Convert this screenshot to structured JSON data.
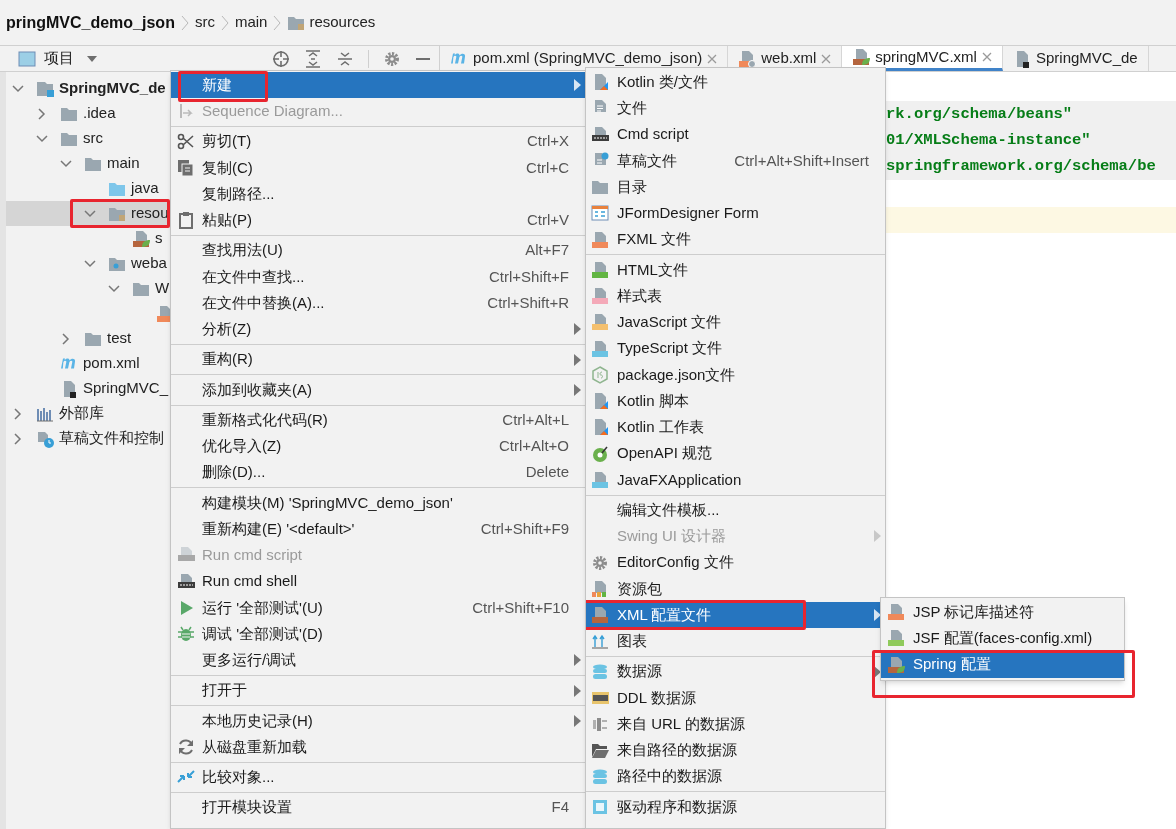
{
  "breadcrumb": [
    {
      "label": "pringMVC_demo_json",
      "kind": "project"
    },
    {
      "label": "src",
      "kind": "plain"
    },
    {
      "label": "main",
      "kind": "plain"
    },
    {
      "label": "resources",
      "kind": "resources"
    }
  ],
  "project_panel": {
    "title": "项目",
    "tree": [
      {
        "label": "SpringMVC_de",
        "kind": "module",
        "expanded": true,
        "selected": false,
        "children": [
          {
            "label": ".idea",
            "kind": "folder",
            "expanded": false,
            "selected": false
          },
          {
            "label": "src",
            "kind": "folder",
            "expanded": true,
            "selected": false,
            "children": [
              {
                "label": "main",
                "kind": "folder",
                "expanded": true,
                "selected": false,
                "children": [
                  {
                    "label": "java",
                    "kind": "source",
                    "selected": false
                  },
                  {
                    "label": "resou",
                    "kind": "resources",
                    "expanded": true,
                    "selected": true,
                    "annotated": true,
                    "children": [
                      {
                        "label": "s",
                        "kind": "spring-xml",
                        "selected": false
                      }
                    ]
                  },
                  {
                    "label": "weba",
                    "kind": "web",
                    "expanded": true,
                    "selected": false,
                    "children": [
                      {
                        "label": "W",
                        "kind": "folder",
                        "expanded": true,
                        "selected": false,
                        "children": [
                          {
                            "kind": "xml",
                            "selected": false
                          }
                        ]
                      }
                    ]
                  }
                ]
              },
              {
                "label": "test",
                "kind": "folder",
                "expanded": false,
                "selected": false
              }
            ]
          },
          {
            "label": "pom.xml",
            "kind": "maven",
            "selected": false
          },
          {
            "label": "SpringMVC_",
            "kind": "iml",
            "selected": false
          }
        ]
      },
      {
        "label": "外部库",
        "kind": "libraries",
        "expanded": false,
        "selected": false
      },
      {
        "label": "草稿文件和控制",
        "kind": "scratches",
        "expanded": false,
        "selected": false
      }
    ]
  },
  "tabs": [
    {
      "label": "pom.xml (SpringMVC_demo_json)",
      "kind": "maven",
      "selected": false,
      "closable": true
    },
    {
      "label": "web.xml",
      "kind": "web-xml",
      "selected": false,
      "closable": true
    },
    {
      "label": "springMVC.xml",
      "kind": "spring-xml",
      "selected": true,
      "closable": true
    },
    {
      "label": "SpringMVC_de",
      "kind": "iml",
      "selected": false,
      "closable": false
    }
  ],
  "editor": {
    "lines": [
      {
        "kind": "attribute",
        "text": "rk.org/schema/beans\""
      },
      {
        "kind": "attribute",
        "text": "01/XMLSchema-instance\""
      },
      {
        "kind": "attribute",
        "text": "springframework.org/schema/be"
      },
      {
        "kind": "blank"
      },
      {
        "kind": "current"
      }
    ]
  },
  "context_menu": {
    "groups": [
      [
        {
          "label": "新建",
          "selected": true,
          "disabled": false,
          "submenu": true,
          "annotated": true
        },
        {
          "label": "Sequence Diagram...",
          "selected": false,
          "disabled": true,
          "submenu": false
        }
      ],
      [
        {
          "label": "剪切(T)",
          "shortcut": "Ctrl+X",
          "selected": false,
          "disabled": false,
          "submenu": false
        },
        {
          "label": "复制(C)",
          "shortcut": "Ctrl+C",
          "selected": false,
          "disabled": false,
          "submenu": false
        },
        {
          "label": "复制路径...",
          "selected": false,
          "disabled": false,
          "submenu": false
        },
        {
          "label": "粘贴(P)",
          "shortcut": "Ctrl+V",
          "selected": false,
          "disabled": false,
          "submenu": false
        }
      ],
      [
        {
          "label": "查找用法(U)",
          "shortcut": "Alt+F7",
          "selected": false,
          "disabled": false,
          "submenu": false
        },
        {
          "label": "在文件中查找...",
          "shortcut": "Ctrl+Shift+F",
          "selected": false,
          "disabled": false,
          "submenu": false
        },
        {
          "label": "在文件中替换(A)...",
          "shortcut": "Ctrl+Shift+R",
          "selected": false,
          "disabled": false,
          "submenu": false
        },
        {
          "label": "分析(Z)",
          "selected": false,
          "disabled": false,
          "submenu": true
        }
      ],
      [
        {
          "label": "重构(R)",
          "selected": false,
          "disabled": false,
          "submenu": true
        }
      ],
      [
        {
          "label": "添加到收藏夹(A)",
          "selected": false,
          "disabled": false,
          "submenu": true
        }
      ],
      [
        {
          "label": "重新格式化代码(R)",
          "shortcut": "Ctrl+Alt+L",
          "selected": false,
          "disabled": false,
          "submenu": false
        },
        {
          "label": "优化导入(Z)",
          "shortcut": "Ctrl+Alt+O",
          "selected": false,
          "disabled": false,
          "submenu": false
        },
        {
          "label": "删除(D)...",
          "shortcut": "Delete",
          "selected": false,
          "disabled": false,
          "submenu": false
        }
      ],
      [
        {
          "label": "构建模块(M) 'SpringMVC_demo_json'",
          "selected": false,
          "disabled": false,
          "submenu": false
        },
        {
          "label": "重新构建(E) '<default>'",
          "shortcut": "Ctrl+Shift+F9",
          "selected": false,
          "disabled": false,
          "submenu": false
        },
        {
          "label": "Run cmd script",
          "selected": false,
          "disabled": true,
          "submenu": false
        },
        {
          "label": "Run cmd shell",
          "selected": false,
          "disabled": false,
          "submenu": false
        },
        {
          "label": "运行 '全部测试'(U)",
          "shortcut": "Ctrl+Shift+F10",
          "selected": false,
          "disabled": false,
          "submenu": false
        },
        {
          "label": "调试 '全部测试'(D)",
          "selected": false,
          "disabled": false,
          "submenu": false
        },
        {
          "label": "更多运行/调试",
          "selected": false,
          "disabled": false,
          "submenu": true
        }
      ],
      [
        {
          "label": "打开于",
          "selected": false,
          "disabled": false,
          "submenu": true
        }
      ],
      [
        {
          "label": "本地历史记录(H)",
          "selected": false,
          "disabled": false,
          "submenu": true
        },
        {
          "label": "从磁盘重新加载",
          "selected": false,
          "disabled": false,
          "submenu": false
        }
      ],
      [
        {
          "label": "比较对象...",
          "selected": false,
          "disabled": false,
          "submenu": false
        }
      ],
      [
        {
          "label": "打开模块设置",
          "shortcut": "F4",
          "selected": false,
          "disabled": false,
          "submenu": false
        }
      ]
    ]
  },
  "new_submenu": {
    "groups": [
      [
        {
          "label": "Kotlin 类/文件",
          "selected": false,
          "disabled": false,
          "submenu": false
        },
        {
          "label": "文件",
          "selected": false,
          "disabled": false,
          "submenu": false
        },
        {
          "label": "Cmd script",
          "selected": false,
          "disabled": false,
          "submenu": false
        },
        {
          "label": "草稿文件",
          "shortcut": "Ctrl+Alt+Shift+Insert",
          "selected": false,
          "disabled": false,
          "submenu": false
        },
        {
          "label": "目录",
          "selected": false,
          "disabled": false,
          "submenu": false
        },
        {
          "label": "JFormDesigner Form",
          "selected": false,
          "disabled": false,
          "submenu": false
        },
        {
          "label": "FXML 文件",
          "selected": false,
          "disabled": false,
          "submenu": false
        }
      ],
      [
        {
          "label": "HTML文件",
          "selected": false,
          "disabled": false,
          "submenu": false
        },
        {
          "label": "样式表",
          "selected": false,
          "disabled": false,
          "submenu": false
        },
        {
          "label": "JavaScript 文件",
          "selected": false,
          "disabled": false,
          "submenu": false
        },
        {
          "label": "TypeScript 文件",
          "selected": false,
          "disabled": false,
          "submenu": false
        },
        {
          "label": "package.json文件",
          "selected": false,
          "disabled": false,
          "submenu": false
        },
        {
          "label": "Kotlin 脚本",
          "selected": false,
          "disabled": false,
          "submenu": false
        },
        {
          "label": "Kotlin 工作表",
          "selected": false,
          "disabled": false,
          "submenu": false
        },
        {
          "label": "OpenAPI 规范",
          "selected": false,
          "disabled": false,
          "submenu": false
        },
        {
          "label": "JavaFXApplication",
          "selected": false,
          "disabled": false,
          "submenu": false
        }
      ],
      [
        {
          "label": "编辑文件模板...",
          "selected": false,
          "disabled": false,
          "submenu": false
        },
        {
          "label": "Swing UI 设计器",
          "selected": false,
          "disabled": true,
          "submenu": true
        },
        {
          "label": "EditorConfig 文件",
          "selected": false,
          "disabled": false,
          "submenu": false
        },
        {
          "label": "资源包",
          "selected": false,
          "disabled": false,
          "submenu": false
        },
        {
          "label": "XML 配置文件",
          "selected": true,
          "disabled": false,
          "submenu": true,
          "annotated": true
        },
        {
          "label": "图表",
          "selected": false,
          "disabled": false,
          "submenu": false
        }
      ],
      [
        {
          "label": "数据源",
          "selected": false,
          "disabled": false,
          "submenu": true
        },
        {
          "label": "DDL 数据源",
          "selected": false,
          "disabled": false,
          "submenu": false
        },
        {
          "label": "来自 URL 的数据源",
          "selected": false,
          "disabled": false,
          "submenu": false
        },
        {
          "label": "来自路径的数据源",
          "selected": false,
          "disabled": false,
          "submenu": false
        },
        {
          "label": "路径中的数据源",
          "selected": false,
          "disabled": false,
          "submenu": false
        }
      ],
      [
        {
          "label": "驱动程序和数据源",
          "selected": false,
          "disabled": false,
          "submenu": false
        }
      ]
    ]
  },
  "xml_submenu": {
    "groups": [
      [
        {
          "label": "JSP 标记库描述符",
          "selected": false,
          "disabled": false,
          "submenu": false
        },
        {
          "label": "JSF 配置(faces-config.xml)",
          "selected": false,
          "disabled": false,
          "submenu": false
        },
        {
          "label": "Spring 配置",
          "selected": true,
          "disabled": false,
          "submenu": false,
          "annotated": true
        }
      ]
    ]
  }
}
